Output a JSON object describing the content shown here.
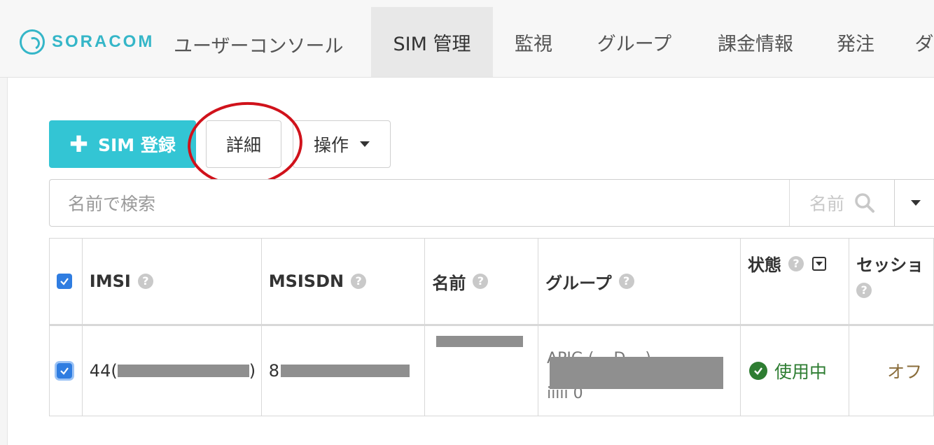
{
  "header": {
    "logo_text": "SORACOM",
    "console_title": "ユーザーコンソール",
    "tabs": [
      {
        "label": "SIM 管理",
        "active": true
      },
      {
        "label": "監視",
        "active": false
      },
      {
        "label": "グループ",
        "active": false
      },
      {
        "label": "課金情報",
        "active": false
      },
      {
        "label": "発注",
        "active": false
      },
      {
        "label": "ダ",
        "active": false
      }
    ]
  },
  "toolbar": {
    "register_label": "SIM 登録",
    "detail_label": "詳細",
    "operations_label": "操作"
  },
  "search": {
    "placeholder": "名前で検索",
    "key_label": "名前"
  },
  "table": {
    "headers": {
      "imsi": "IMSI",
      "msisdn": "MSISDN",
      "name": "名前",
      "group": "グループ",
      "status": "状態",
      "session": "セッショ"
    },
    "help_glyph": "?",
    "rows": [
      {
        "selected": true,
        "imsi_prefix": "44(",
        "imsi_suffix": ")",
        "msisdn_prefix": "8",
        "group_fragment_top": "APIG (...  D...   )-",
        "group_fragment_bottom": "iiiii   0",
        "status": "使用中",
        "session": "オフ"
      }
    ]
  },
  "colors": {
    "accent": "#33c5d4",
    "brand": "#35b6c8",
    "status_ok": "#2e7d32",
    "highlight": "#d0121b",
    "checkbox": "#2f7de1"
  }
}
